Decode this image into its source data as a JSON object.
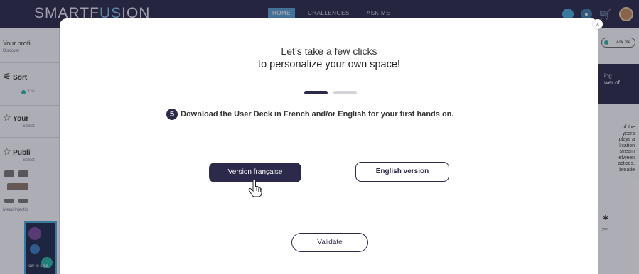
{
  "app": {
    "logo_main": "SMARTF",
    "logo_highlight": "US",
    "logo_rest": "ION",
    "nav": [
      "HOME",
      "CHALLENGES",
      "ASK ME"
    ],
    "active_nav": "HOME"
  },
  "left_panel": {
    "profile_label": "Your profil",
    "profile_sub": "Discover",
    "sort_label": "Sort",
    "sort_option": "Dis",
    "your_label": "Your",
    "your_sub": "Select",
    "publi_label": "Publi",
    "publi_sub": "Select",
    "metal_label": "Metal Injectio",
    "howto_label": "How to crea"
  },
  "right_panel": {
    "askme_label": "Ask me",
    "banner_line1": "ing",
    "banner_line2": "wer of",
    "paragraph": "of the\nyears\nplays a\nlication\nstream\netween\nactices,\nbroade",
    "small_label": "yse"
  },
  "modal": {
    "title_line1": "Let’s take a few clicks",
    "title_line2": "to personalize your own space!",
    "step_count": 2,
    "active_step": 1,
    "step_number": "5",
    "instruction": "Download the User Deck in French and/or English for your first hands on.",
    "btn_french": "Version française",
    "btn_english": "English version",
    "btn_validate": "Validate",
    "close_symbol": "×"
  },
  "colors": {
    "primary": "#2c2a4a",
    "accent": "#4aa8d8",
    "teal": "#2bb3a3"
  }
}
